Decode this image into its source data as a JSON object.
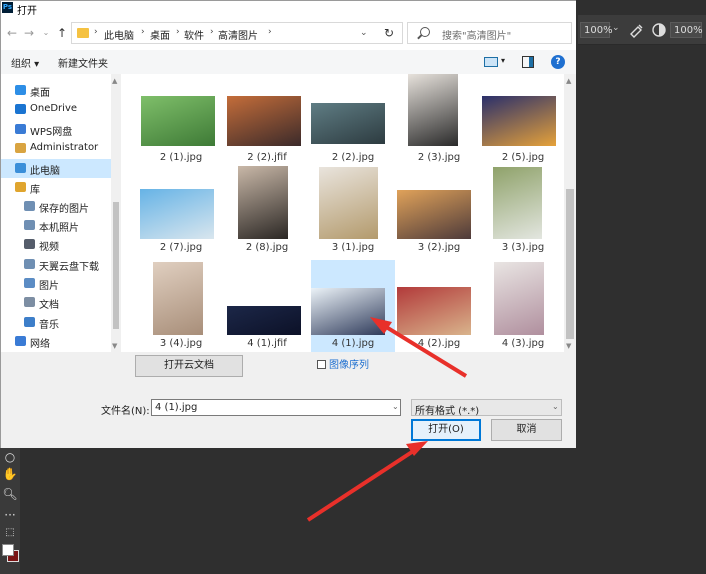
{
  "dialog": {
    "title": "打开",
    "app_logo": "Ps"
  },
  "nav": {
    "breadcrumbs": [
      "此电脑",
      "桌面",
      "软件",
      "高清图片"
    ],
    "search_placeholder": "搜索\"高清图片\""
  },
  "toolbar": {
    "organize": "组织 ▾",
    "new_folder": "新建文件夹"
  },
  "sidebar": {
    "items": [
      {
        "label": "桌面",
        "icon": "desktop-icon",
        "color": "#2d8ee6"
      },
      {
        "label": "OneDrive",
        "icon": "cloud-icon",
        "color": "#1a74d1"
      },
      {
        "label": "WPS网盘",
        "icon": "cloud-icon",
        "color": "#3a7bd5"
      },
      {
        "label": "Administrator",
        "icon": "user-icon",
        "color": "#d9a441"
      },
      {
        "label": "此电脑",
        "icon": "computer-icon",
        "color": "#3b8fd9"
      },
      {
        "label": "库",
        "icon": "library-icon",
        "color": "#e0a52e"
      },
      {
        "label": "保存的图片",
        "icon": "folder-pictures-icon",
        "color": "#6f8fb3"
      },
      {
        "label": "本机照片",
        "icon": "folder-pictures-icon",
        "color": "#6f8fb3"
      },
      {
        "label": "视频",
        "icon": "video-icon",
        "color": "#555d6b"
      },
      {
        "label": "天翼云盘下载",
        "icon": "folder-pictures-icon",
        "color": "#6f8fb3"
      },
      {
        "label": "图片",
        "icon": "pictures-icon",
        "color": "#5b8cc4"
      },
      {
        "label": "文档",
        "icon": "documents-icon",
        "color": "#7d8ea3"
      },
      {
        "label": "音乐",
        "icon": "music-icon",
        "color": "#3d7ec9"
      },
      {
        "label": "网络",
        "icon": "network-icon",
        "color": "#3a7bd5"
      }
    ]
  },
  "files": [
    {
      "name": "2 (1).jpg",
      "colors": [
        "#7fbf6a",
        "#3e7a36"
      ]
    },
    {
      "name": "2 (2).jfif",
      "colors": [
        "#c46d3a",
        "#3b2a2a"
      ]
    },
    {
      "name": "2 (2).jpg",
      "colors": [
        "#5f7d84",
        "#2d3b40"
      ]
    },
    {
      "name": "2 (3).jpg",
      "colors": [
        "#e7e2dc",
        "#2a2a2a"
      ]
    },
    {
      "name": "2 (5).jpg",
      "colors": [
        "#2a2f6b",
        "#e6a23a"
      ]
    },
    {
      "name": "2 (7).jpg",
      "colors": [
        "#66b3e6",
        "#d9e6ee"
      ]
    },
    {
      "name": "2 (8).jpg",
      "colors": [
        "#c9b8a8",
        "#2b2724"
      ]
    },
    {
      "name": "3 (1).jpg",
      "colors": [
        "#e9e4dd",
        "#b39a6c"
      ]
    },
    {
      "name": "3 (2).jpg",
      "colors": [
        "#e0a25a",
        "#4d3a3a"
      ]
    },
    {
      "name": "3 (3).jpg",
      "colors": [
        "#8fa26a",
        "#e3e6e0"
      ]
    },
    {
      "name": "3 (4).jpg",
      "colors": [
        "#e0cfc0",
        "#a88e79"
      ]
    },
    {
      "name": "4 (1).jfif",
      "colors": [
        "#1c2748",
        "#0c1127"
      ]
    },
    {
      "name": "4 (1).jpg",
      "colors": [
        "#ecf3f8",
        "#2e3a5a"
      ]
    },
    {
      "name": "4 (2).jpg",
      "colors": [
        "#b23a3a",
        "#d9b48c"
      ]
    },
    {
      "name": "4 (3).jpg",
      "colors": [
        "#e9e5e3",
        "#b08f9e"
      ]
    }
  ],
  "bottom": {
    "cloud_button": "打开云文档",
    "image_sequence": "图像序列",
    "filename_label": "文件名(N):",
    "filename_value": "4 (1).jpg",
    "filter_value": "所有格式 (*.*)",
    "open_button": "打开(O)",
    "cancel_button": "取消"
  },
  "photoshop": {
    "zoom_left": "100%",
    "zoom_right": "100%",
    "annotation_color": "#e8302a"
  }
}
